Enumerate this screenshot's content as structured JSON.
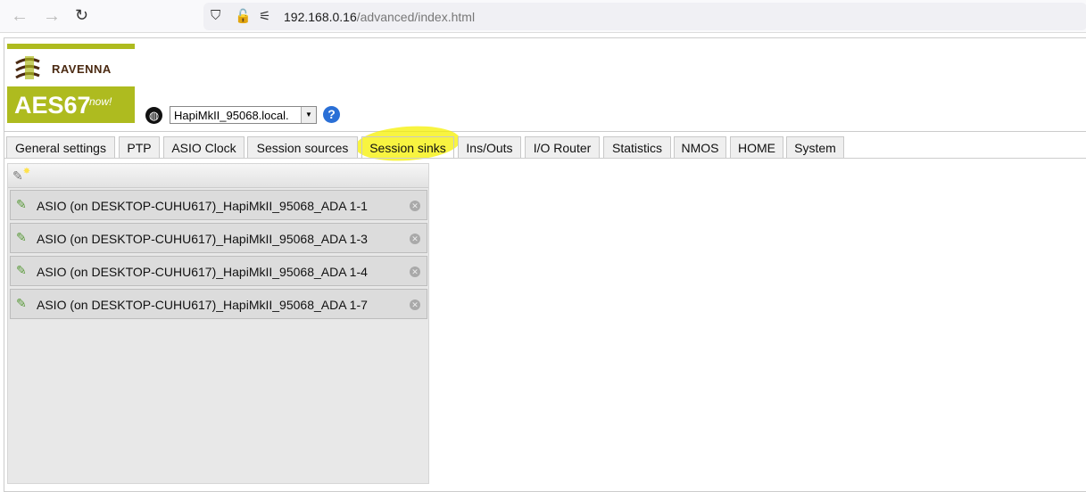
{
  "browser": {
    "url_host": "192.168.0.16",
    "url_path": "/advanced/index.html"
  },
  "logo": {
    "brand": "RAVENNA",
    "product": "AES67",
    "tagline": "now!"
  },
  "device_select": {
    "value": "HapiMkII_95068.local."
  },
  "tabs": [
    {
      "label": "General settings"
    },
    {
      "label": "PTP"
    },
    {
      "label": "ASIO Clock"
    },
    {
      "label": "Session sources"
    },
    {
      "label": "Session sinks",
      "active": true
    },
    {
      "label": "Ins/Outs"
    },
    {
      "label": "I/O Router"
    },
    {
      "label": "Statistics"
    },
    {
      "label": "NMOS"
    },
    {
      "label": "HOME"
    },
    {
      "label": "System"
    }
  ],
  "sinks": [
    {
      "name": "ASIO (on DESKTOP-CUHU617)_HapiMkII_95068_ADA 1-1"
    },
    {
      "name": "ASIO (on DESKTOP-CUHU617)_HapiMkII_95068_ADA 1-3"
    },
    {
      "name": "ASIO (on DESKTOP-CUHU617)_HapiMkII_95068_ADA 1-4"
    },
    {
      "name": "ASIO (on DESKTOP-CUHU617)_HapiMkII_95068_ADA 1-7"
    }
  ],
  "colors": {
    "brand_green": "#aebb1f",
    "highlight": "#f6f000"
  }
}
